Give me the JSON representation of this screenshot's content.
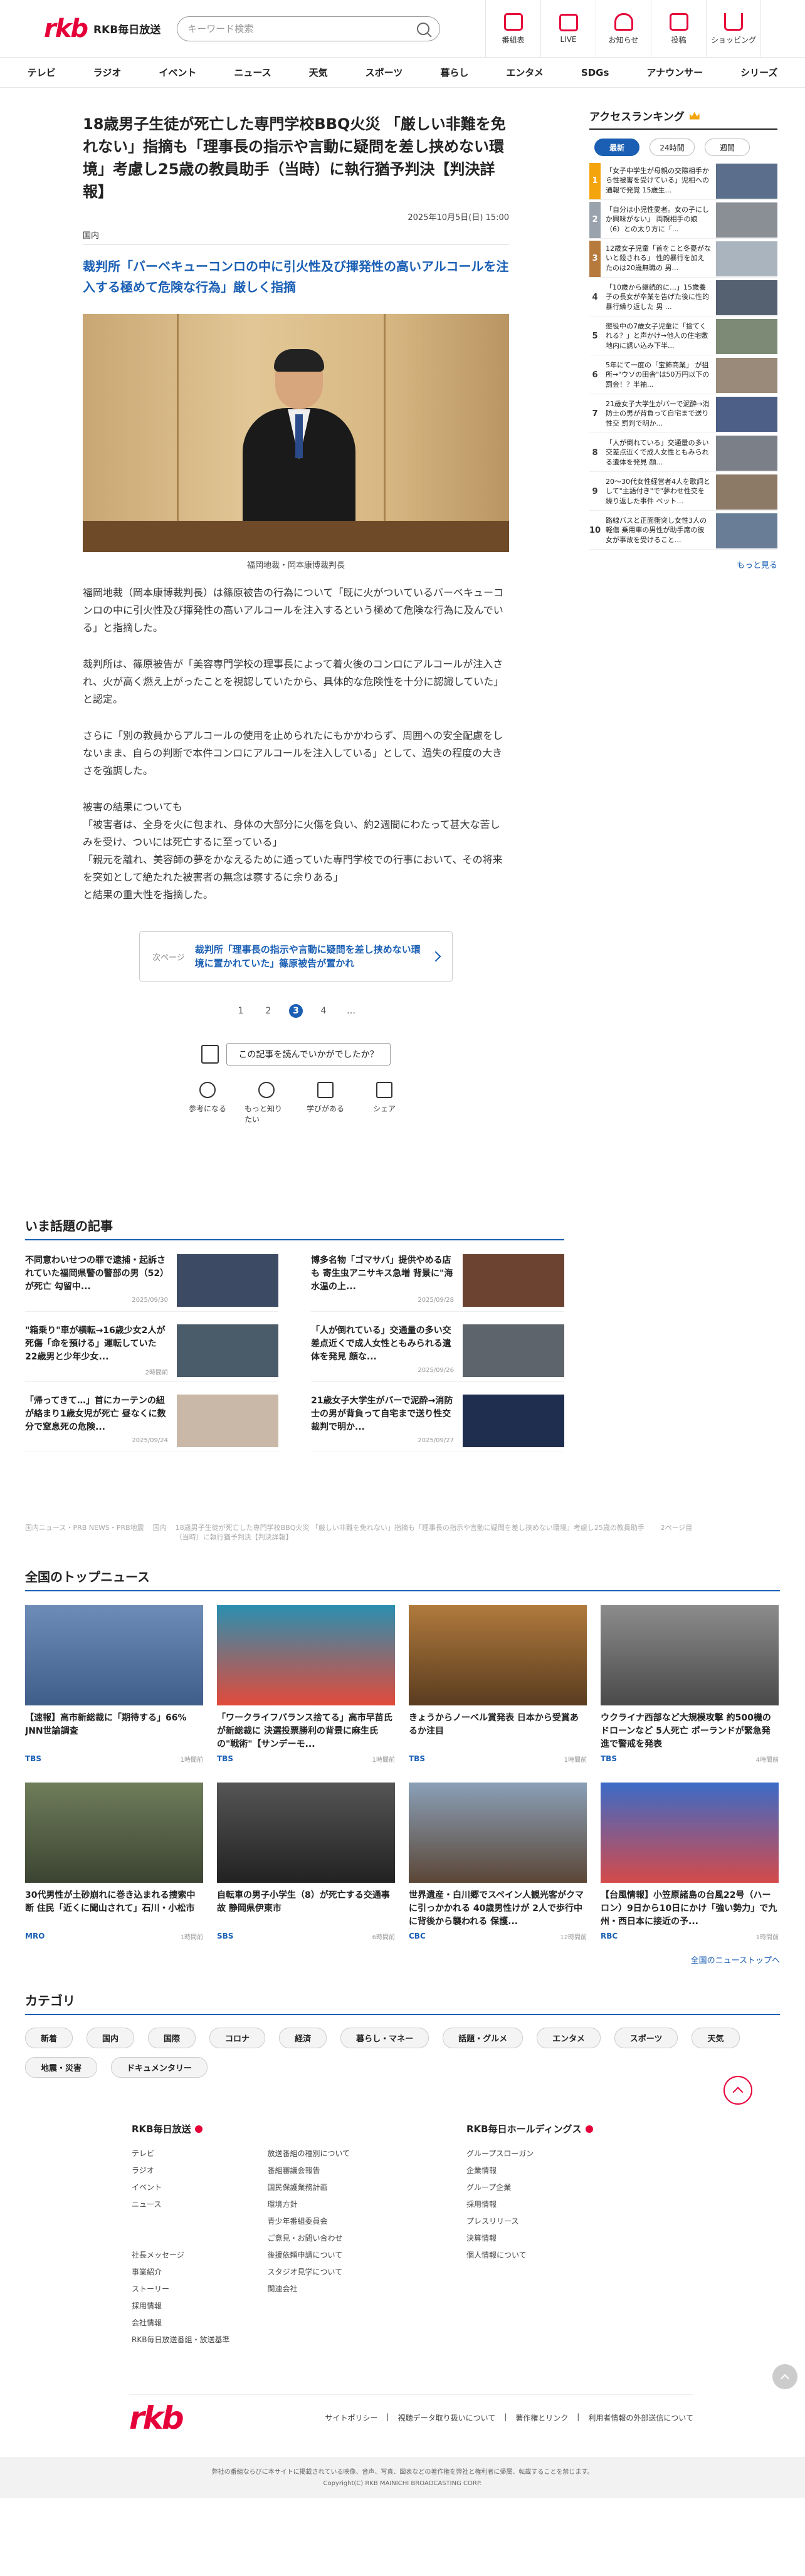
{
  "header": {
    "logo_mark": "rkb",
    "logo_text": "RKB毎日放送",
    "search_placeholder": "キーワード検索",
    "icons": [
      {
        "label": "番組表",
        "icon": "calendar-icon"
      },
      {
        "label": "LIVE",
        "icon": "live-icon"
      },
      {
        "label": "お知らせ",
        "icon": "bell-icon"
      },
      {
        "label": "投稿",
        "icon": "pen-icon"
      },
      {
        "label": "ショッピング",
        "icon": "cart-icon"
      }
    ]
  },
  "nav": [
    "テレビ",
    "ラジオ",
    "イベント",
    "ニュース",
    "天気",
    "スポーツ",
    "暮らし",
    "エンタメ",
    "SDGs",
    "アナウンサー",
    "シリーズ"
  ],
  "article": {
    "title": "18歳男子生徒が死亡した専門学校BBQ火災 「厳しい非難を免れない」指摘も「理事長の指示や言動に疑問を差し挟めない環境」考慮し25歳の教員助手（当時）に執行猶予判決【判決詳報】",
    "date": "2025年10月5日(日) 15:00",
    "category": "国内",
    "lead": "裁判所「バーベキューコンロの中に引火性及び揮発性の高いアルコールを注入する極めて危険な行為」厳しく指摘",
    "caption": "福岡地裁・岡本康博裁判長",
    "paragraphs": [
      "福岡地裁（岡本康博裁判長）は篠原被告の行為について「既に火がついているバーベキューコンロの中に引火性及び揮発性の高いアルコールを注入するという極めて危険な行為に及んでいる」と指摘した。",
      "裁判所は、篠原被告が「美容専門学校の理事長によって着火後のコンロにアルコールが注入され、火が高く燃え上がったことを視認していたから、具体的な危険性を十分に認識していた」と認定。",
      "さらに「別の教員からアルコールの使用を止められたにもかかわらず、周囲への安全配慮をしないまま、自らの判断で本件コンロにアルコールを注入している」として、過失の程度の大きさを強調した。",
      "被害の結果についても\n「被害者は、全身を火に包まれ、身体の大部分に火傷を負い、約2週間にわたって甚大な苦しみを受け、ついには死亡するに至っている」\n「親元を離れ、美容師の夢をかなえるために通っていた専門学校での行事において、その将来を突如として絶たれた被害者の無念は察するに余りある」\nと結果の重大性を指摘した。"
    ],
    "next_label": "次ページ",
    "next_text": "裁判所「理事長の指示や言動に疑問を差し挟めない環境に置かれていた」篠原被告が置かれ",
    "pages": [
      "1",
      "2",
      "3",
      "4",
      "…"
    ],
    "current_page": "3",
    "survey_q": "この記事を読んでいかがでしたか？",
    "reactions": [
      {
        "label": "参考になる",
        "icon": "bulb-icon"
      },
      {
        "label": "もっと知りたい",
        "icon": "magnifier-icon"
      },
      {
        "label": "学びがある",
        "icon": "book-icon"
      },
      {
        "label": "シェア",
        "icon": "share-icon"
      }
    ]
  },
  "ranking": {
    "title": "アクセスランキング",
    "tabs": [
      "最新",
      "24時間",
      "週間"
    ],
    "items": [
      {
        "no": "1",
        "text": "「女子中学生が母親の交際相手から性被害を受けている」児相への通報で発覚 15歳生..."
      },
      {
        "no": "2",
        "text": "「自分は小児性愛者。女の子にしか興味がない」 両親相手の娘（6）との太り方に「..."
      },
      {
        "no": "3",
        "text": "12歳女子児童「首をこと冬憂がないと殺される」 性的暴行を加えたのは20歳無職の 男..."
      },
      {
        "no": "4",
        "text": "「10歳から継続的に…」15歳養子の長女が卒業を告げた後に性的暴行繰り返した 男 ..."
      },
      {
        "no": "5",
        "text": "懲役中の7歳女子児童に「捨てくれる？」と声かけ→他人の住宅敷地内に誘い込み下半..."
      },
      {
        "no": "6",
        "text": "5年にて一度の「宝飾商業」 が狙所→\"ウソの田舎\"は50万円以下の罰金！？半袖..."
      },
      {
        "no": "7",
        "text": "21歳女子大学生がバーで泥酔→消防士の男が背負って自宅まで送り性交 罰判で明か..."
      },
      {
        "no": "8",
        "text": "「人が倒れている」交通量の多い交差点近くで成人女性ともみられる遺体を発見 顔..."
      },
      {
        "no": "9",
        "text": "20〜30代女性経営者4人を歌詞として\"主語付き\"で\"夢わせ性交を繰り返した事件 ベット..."
      },
      {
        "no": "10",
        "text": "路線バスと正面衝突し女性3人の軽傷 乗用車の男性が助手席の彼女が事故を受けること..."
      }
    ],
    "more": "もっと見る"
  },
  "trending": {
    "title": "いま話題の記事",
    "items": [
      {
        "text": "不同意わいせつの罪で逮捕・起訴されていた福岡県警の警部の男（52）が死亡 勾留中...",
        "time": "2025/09/30"
      },
      {
        "text": "博多名物「ゴマサバ」提供やめる店も 寄生虫アニサキス急増 背景に\"海水温の上...",
        "time": "2025/09/28"
      },
      {
        "text": "\"箱乗り\"車が横転→16歳少女2人が死傷「命を預ける」運転していた22歳男と少年少女...",
        "time": "2時間前"
      },
      {
        "text": "「人が倒れている」交通量の多い交差点近くで成人女性ともみられる遺体を発見 顔な...",
        "time": "2025/09/26"
      },
      {
        "text": "「帰ってきて…」首にカーテンの紐が絡まり1歳女児が死亡 昼なくに数分で窒息死の危険...",
        "time": "2025/09/24"
      },
      {
        "text": "21歳女子大学生がバーで泥酔→消防士の男が背負って自宅まで送り性交 裁判で明か...",
        "time": "2025/09/27"
      }
    ]
  },
  "breadcrumb": [
    "国内ニュース・PRB NEWS・PRB地震",
    "国内",
    "18歳男子生徒が死亡した専門学校BBQ火災 「厳しい非難を免れない」指摘も「理事長の指示や言動に疑問を差し挟めない環境」考慮し25歳の教員助手（当時）に執行猶予判決【判決詳報】",
    "2ページ目"
  ],
  "topnews": {
    "title": "全国のトップニュース",
    "items": [
      {
        "text": "【速報】高市新総裁に「期待する」66% JNN世論調査",
        "src": "TBS",
        "time": "1時間前"
      },
      {
        "text": "「ワークライフバランス捨てる」高市早苗氏が新総裁に 決選投票勝利の背景に麻生氏の\"戦術\"【サンデーモ...",
        "src": "TBS",
        "time": "1時間前"
      },
      {
        "text": "きょうからノーベル賞発表 日本から受賞あるか注目",
        "src": "TBS",
        "time": "1時間前"
      },
      {
        "text": "ウクライナ西部など大規模攻撃 約500機のドローンなど 5人死亡 ポーランドが緊急発進で警戒を発表",
        "src": "TBS",
        "time": "4時間前"
      },
      {
        "text": "30代男性が土砂崩れに巻き込まれる捜索中断 住民「近くに聞山されて」石川・小松市",
        "src": "MRO",
        "time": "1時間前"
      },
      {
        "text": "自転車の男子小学生（8）が死亡する交通事故 静岡県伊東市",
        "src": "SBS",
        "time": "6時間前"
      },
      {
        "text": "世界遺産・白川郷でスペイン人観光客がクマに引っかかれる 40歳男性けが 2人で歩行中に背後から襲われる 保護...",
        "src": "CBC",
        "time": "12時間前"
      },
      {
        "text": "【台風情報】小笠原諸島の台風22号（ハーロン）9日から10日にかけ「強い勢力」で九州・西日本に接近の予...",
        "src": "RBC",
        "time": "1時間前"
      }
    ],
    "more": "全国のニューストップへ"
  },
  "categories": {
    "title": "カテゴリ",
    "items": [
      "新着",
      "国内",
      "国際",
      "コロナ",
      "経済",
      "暮らし・マネー",
      "話題・グルメ",
      "エンタメ",
      "スポーツ",
      "天気",
      "地震・災害",
      "ドキュメンタリー"
    ]
  },
  "footer": {
    "col1_title": "RKB毎日放送",
    "col1_a": [
      "テレビ",
      "ラジオ",
      "イベント",
      "ニュース",
      "",
      "",
      "社長メッセージ",
      "事業紹介",
      "ストーリー",
      "採用情報",
      "会社情報",
      "RKB毎日放送番組・放送基準"
    ],
    "col1_b": [
      "放送番組の種別について",
      "番組審議会報告",
      "国民保護業務計画",
      "環境方針",
      "青少年番組委員会",
      "ご意見・お問い合わせ",
      "後援依頼申請について",
      "スタジオ見学について",
      "関連会社"
    ],
    "col2_title": "RKB毎日ホールディングス",
    "col2": [
      "グループスローガン",
      "企業情報",
      "グループ企業",
      "採用情報",
      "プレスリリース",
      "決算情報",
      "個人情報について"
    ],
    "links": [
      "サイトポリシー",
      "視聴データ取り扱いについて",
      "著作権とリンク",
      "利用者情報の外部送信について"
    ],
    "copy1": "弊社の番組ならびに本サイトに掲載されている映像、音声、写真、図表などの著作権を弊社と権利者に帰属、転載することを禁じます。",
    "copy2": "Copyright(C) RKB MAINICHI BROADCASTING CORP."
  },
  "colors": {
    "brand": "#e60039",
    "link": "#1a5fb4"
  }
}
